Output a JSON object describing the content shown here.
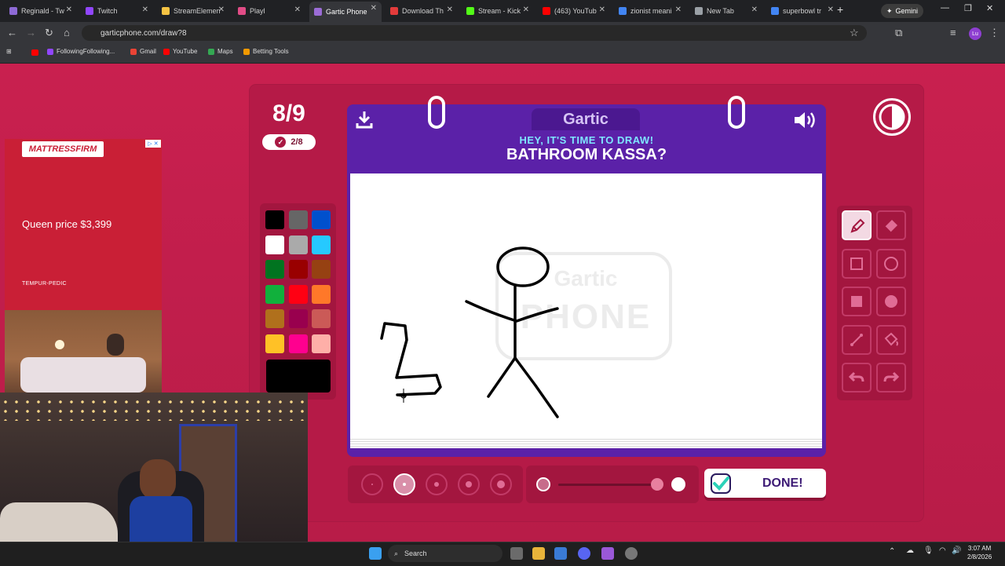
{
  "browser": {
    "tabs": [
      {
        "label": "Reginald - Tw",
        "color": "#8e6ad6"
      },
      {
        "label": "Twitch",
        "color": "#9146ff"
      },
      {
        "label": "StreamElemen",
        "color": "#f6c343"
      },
      {
        "label": "Playl",
        "prefix": "🟩 🟩 -",
        "color": "#e14c86"
      },
      {
        "label": "Gartic Phone",
        "color": "#9b6cd6",
        "active": true
      },
      {
        "label": "Download Th",
        "color": "#e33b3b"
      },
      {
        "label": "Stream - Kick",
        "color": "#53fc18"
      },
      {
        "label": "(463) YouTub",
        "color": "#ff0000"
      },
      {
        "label": "zionist meani",
        "color": "#4285f4"
      },
      {
        "label": "New Tab",
        "color": "#9aa0a6"
      },
      {
        "label": "superbowl tr",
        "color": "#4285f4"
      }
    ],
    "gemini_label": "Gemini",
    "url": "garticphone.com/draw?8",
    "profile": "Lu",
    "bookmarks": [
      {
        "label": "FollowingFollowing...",
        "color": "#9146ff"
      },
      {
        "label": "Gmail",
        "color": "#ea4335"
      },
      {
        "label": "YouTube",
        "color": "#ff0000"
      },
      {
        "label": "Maps",
        "color": "#34a853"
      },
      {
        "label": "Betting Tools",
        "color": "#f29900"
      }
    ]
  },
  "game": {
    "round": "8/9",
    "done_count": "2/8",
    "logo": "Gartic",
    "subtitle": "HEY, IT'S TIME TO DRAW!",
    "prompt": "BATHROOM KASSA?",
    "watermark_top": "Gartic",
    "watermark_bottom": "PHONE",
    "done_label": "DONE!",
    "palette": [
      "#000000",
      "#666666",
      "#0050cd",
      "#ffffff",
      "#aaaaaa",
      "#26c9ff",
      "#017420",
      "#990000",
      "#964112",
      "#11b03c",
      "#ff0013",
      "#ff7829",
      "#b0701c",
      "#99004e",
      "#cb5a57",
      "#ffc126",
      "#ff008f",
      "#feafa8"
    ],
    "current_color": "#000000",
    "tools": [
      "pencil-icon",
      "eraser-icon",
      "square-outline-icon",
      "circle-outline-icon",
      "square-fill-icon",
      "circle-fill-icon",
      "line-icon",
      "fill-bucket-icon",
      "undo-icon",
      "redo-icon"
    ],
    "brush_sizes_selected": 2,
    "opacity_value": 1
  },
  "ad": {
    "brand": "MATTRESSFIRM",
    "price": "Queen price $3,399",
    "sub_brand": "TEMPUR-PEDIC"
  },
  "taskbar": {
    "search": "Search",
    "time": "3:07 AM",
    "date": "2/8/2026"
  }
}
